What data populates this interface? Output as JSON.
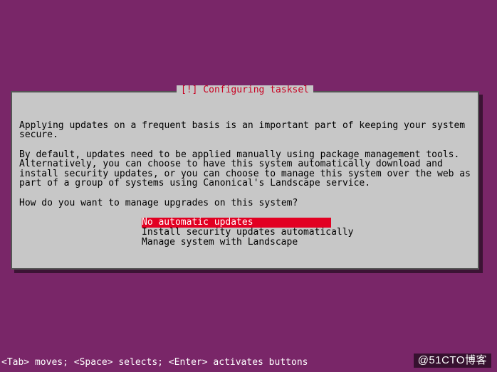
{
  "dialog": {
    "title": "[!] Configuring tasksel",
    "paragraph1": "Applying updates on a frequent basis is an important part of keeping your system secure.",
    "paragraph2": "By default, updates need to be applied manually using package management tools. Alternatively, you can choose to have this system automatically download and install security updates, or you can choose to manage this system over the web as part of a group of systems using Canonical's Landscape service.",
    "question": "How do you want to manage upgrades on this system?",
    "options": [
      "No automatic updates",
      "Install security updates automatically",
      "Manage system with Landscape"
    ],
    "selected_index": 0
  },
  "bottom_bar": "<Tab> moves; <Space> selects; <Enter> activates buttons",
  "watermark": "@51CTO博客"
}
